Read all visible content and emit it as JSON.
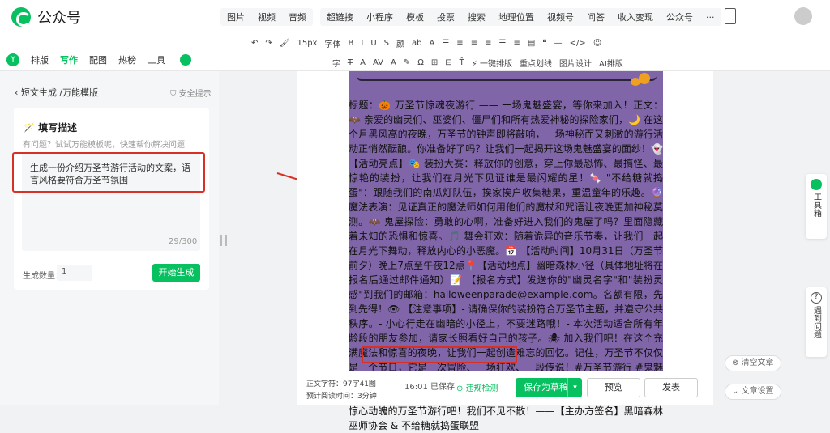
{
  "app": {
    "name": "公众号"
  },
  "top_menu": {
    "group1": [
      "图片",
      "视频",
      "音频"
    ],
    "group2": [
      "超链接",
      "小程序",
      "模板",
      "投票",
      "搜索",
      "地理位置",
      "视频号",
      "问答",
      "收入变现",
      "公众号",
      "···"
    ]
  },
  "format_row1": [
    "↶",
    "↷",
    "🖌",
    "15px",
    "字体",
    "B",
    "I",
    "U",
    "S",
    "颜",
    "ab",
    "A",
    "☰",
    "≡",
    "≡",
    "≡",
    "☰",
    "≡",
    "▤",
    "❝",
    "—",
    "</>",
    "☺"
  ],
  "format_row2": [
    "字",
    "T̶",
    "A",
    "AV",
    "A",
    "✎",
    "Ω",
    "⊞",
    "⊟",
    "T̂",
    "⚡ 一键排版",
    "重点划线",
    "图片设计",
    "AI排版"
  ],
  "ai_tabs": [
    "排版",
    "写作",
    "配图",
    "热榜",
    "工具"
  ],
  "left_panel": {
    "breadcrumb": "短文生成 /万能模版",
    "safety": "安全提示",
    "card_title": "🪄 填写描述",
    "card_sub": "有问题？试试万能模板呢，快速帮你解决问题",
    "prompt": "生成一份介绍万圣节游行活动的文案，语言风格要符合万圣节氛围",
    "counter": "29/300",
    "count_label": "生成数量：",
    "count_value": "1",
    "generate": "开始生成"
  },
  "article": {
    "text": "标题：🎃 万圣节惊魂夜游行 —— 一场鬼魅盛宴，等你来加入！正文：🦇 亲爱的幽灵们、巫婆们、僵尸们和所有热爱神秘的探险家们，🌙 在这个月黑风高的夜晚，万圣节的钟声即将敲响，一场神秘而又刺激的游行活动正悄然酝酿。你准备好了吗？让我们一起揭开这场鬼魅盛宴的面纱！👻 【活动亮点】🎭 装扮大赛：释放你的创意，穿上你最恐怖、最搞怪、最惊艳的装扮，让我们在月光下见证谁是最闪耀的星！🍬 \"不给糖就捣蛋\"：跟随我们的南瓜灯队伍，挨家挨户收集糖果，重温童年的乐趣。🔮 魔法表演：见证真正的魔法师如何用他们的魔杖和咒语让夜晚更加神秘莫测。🦇 鬼屋探险：勇敢的心啊，准备好进入我们的鬼屋了吗？里面隐藏着未知的恐惧和惊喜。🎵 舞会狂欢：随着诡异的音乐节奏，让我们一起在月光下舞动，释放内心的小恶魔。📅 【活动时间】10月31日（万圣节前夕）晚上7点至午夜12点📍【活动地点】幽暗森林小径（具体地址将在报名后通过邮件通知）📝 【报名方式】发送你的\"幽灵名字\"和\"装扮灵感\"到我们的邮箱：halloweenparade@example.com。名额有限，先到先得！👁 【注意事项】- 请确保你的装扮符合万圣节主题，并遵守公共秩序。- 小心行走在幽暗的小径上，不要迷路哦！- 本次活动适合所有年龄段的朋友参加，请家长照看好自己的孩子。🕷 加入我们吧！在这个充满魔法和惊喜的夜晚，让我们一起创造难忘的回忆。记住，万圣节不仅仅是一个节日，它是一次冒险、一场狂欢、一段传说！#万圣节游行 #鬼魅盛宴 #不给糖就捣蛋 #南瓜灯舞会结束语：✨ 在这个充满神秘的夜晚，让我们一起成为传说的一部分。穿上你的斗篷，拿起你的魔杖，加入这场惊心动魄的万圣节游行吧！我们不见不散！——【主办方签名】黑暗森林巫师协会 & 不给糖就捣蛋联盟"
  },
  "status": {
    "word_label": "正文字符：",
    "word_count": "97字41图",
    "read_label": "预计阅读时间：",
    "read_time": "3分钟",
    "time": "16:01",
    "saved": "已保存",
    "check": "违规检测",
    "save": "保存为草稿",
    "preview": "预览",
    "publish": "发表"
  },
  "side": {
    "tools": "工具箱",
    "issue": "遇到问题",
    "clear": "清空文章",
    "settings": "文章设置"
  },
  "colors": {
    "accent": "#07c160",
    "highlight": "#d93025",
    "poster": "#8066a8"
  }
}
